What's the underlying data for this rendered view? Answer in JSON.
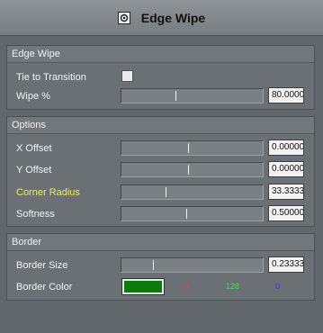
{
  "window": {
    "title": "Edge Wipe",
    "icon": "effect-icon"
  },
  "sections": {
    "edge_wipe": {
      "header": "Edge Wipe",
      "tie_label": "Tie to Transition",
      "tie_checked": false,
      "wipe_label": "Wipe %",
      "wipe_value": "80.0000",
      "wipe_level": 0.38
    },
    "options": {
      "header": "Options",
      "x_label": "X Offset",
      "x_value": "0.00000",
      "x_level": 0.47,
      "y_label": "Y Offset",
      "y_value": "0.00000",
      "y_level": 0.47,
      "corner_label": "Corner Radius",
      "corner_value": "33.3333",
      "corner_level": 0.31,
      "soft_label": "Softness",
      "soft_value": "0.50000",
      "soft_level": 0.46
    },
    "border": {
      "header": "Border",
      "size_label": "Border Size",
      "size_value": "0.23333",
      "size_level": 0.22,
      "color_label": "Border Color",
      "color_hex": "#0d7a0d",
      "r": "0",
      "g": "128",
      "b": "0",
      "r_color": "#ff3b3b",
      "g_color": "#3fe03f",
      "b_color": "#3a3aff"
    }
  }
}
